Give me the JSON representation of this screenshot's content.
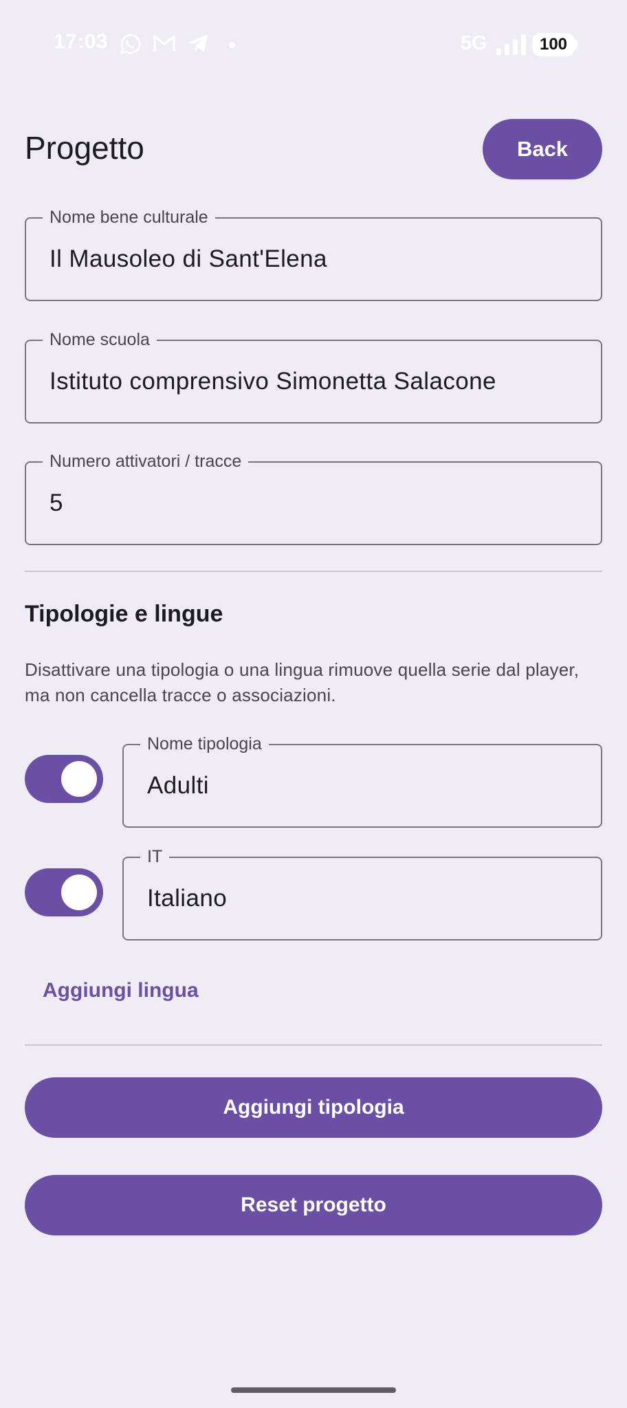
{
  "status_bar": {
    "time": "17:03",
    "network": "5G",
    "battery": "100",
    "notification_icons": [
      "whatsapp-icon",
      "gmail-icon",
      "telegram-icon"
    ]
  },
  "header": {
    "title": "Progetto",
    "back_label": "Back"
  },
  "form": {
    "bene": {
      "label": "Nome bene culturale",
      "value": "Il Mausoleo di Sant'Elena"
    },
    "scuola": {
      "label": "Nome scuola",
      "value": "Istituto comprensivo Simonetta Salacone"
    },
    "attivatori": {
      "label": "Numero attivatori / tracce",
      "value": "5"
    }
  },
  "types_section": {
    "title": "Tipologie e lingue",
    "description": "Disattivare una tipologia o una lingua rimuove quella serie dal player, ma non cancella tracce o associazioni.",
    "tipologia": {
      "label": "Nome tipologia",
      "value": "Adulti",
      "enabled": true
    },
    "lingua": {
      "label": "IT",
      "value": "Italiano",
      "enabled": true
    },
    "add_language_label": "Aggiungi lingua"
  },
  "actions": {
    "add_type_label": "Aggiungi tipologia",
    "reset_label": "Reset progetto"
  },
  "colors": {
    "primary": "#6a4fa4",
    "background": "#efecf6",
    "outline": "#77737f"
  }
}
